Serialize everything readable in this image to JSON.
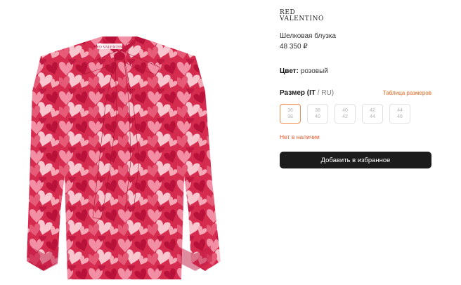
{
  "product": {
    "image_alt": "silk blouse with heart print",
    "brand_line1": "RED",
    "brand_line2": "VALENTINO",
    "label_text": "RED VALENTINO",
    "title": "Шелковая блузка",
    "price": "48 350 ₽"
  },
  "color": {
    "label": "Цвет:",
    "value": "розовый"
  },
  "size": {
    "label_main": "Размер",
    "label_it": "(IT",
    "label_sep": " / ",
    "label_ru": "RU)",
    "guide_link": "Таблица размеров",
    "options": [
      {
        "it": "36",
        "ru": "38"
      },
      {
        "it": "38",
        "ru": "40"
      },
      {
        "it": "40",
        "ru": "42"
      },
      {
        "it": "42",
        "ru": "44"
      },
      {
        "it": "44",
        "ru": "46"
      }
    ],
    "availability": "Нет в наличии"
  },
  "actions": {
    "favorite_label": "Добавить в избранное"
  },
  "colors": {
    "accent": "#e0651e",
    "button_bg": "#1c1c1c",
    "blouse_base": "#d42b4f"
  }
}
